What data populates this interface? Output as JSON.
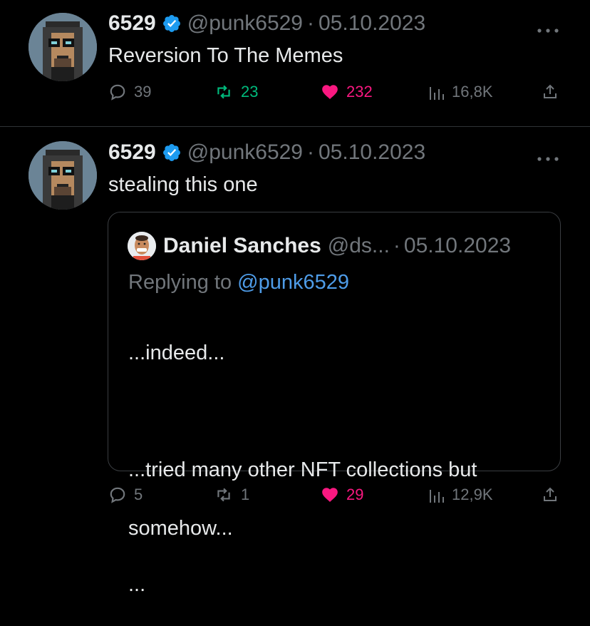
{
  "tweets": [
    {
      "name": "6529",
      "handle": "@punk6529",
      "separator": "·",
      "date": "05.10.2023",
      "text": "Reversion To The Memes",
      "stats": {
        "replies": "39",
        "retweets": "23",
        "likes": "232",
        "views": "16,8K"
      },
      "retweeted": true,
      "liked": true
    },
    {
      "name": "6529",
      "handle": "@punk6529",
      "separator": "·",
      "date": "05.10.2023",
      "text": "stealing this one",
      "quote": {
        "name": "Daniel Sanches",
        "handle": "@ds...",
        "separator": "·",
        "date": "05.10.2023",
        "replying_prefix": "Replying to ",
        "replying_to": "@punk6529",
        "body_lines": [
          "...indeed...",
          "",
          "...tried many other NFT collections but",
          "somehow...",
          "..."
        ]
      },
      "stats": {
        "replies": "5",
        "retweets": "1",
        "likes": "29",
        "views": "12,9K"
      },
      "retweeted": false,
      "liked": true
    }
  ],
  "colors": {
    "background": "#000000",
    "text": "#e7e9ea",
    "muted": "#71767b",
    "verified": "#1d9bf0",
    "retweet_active": "#00ba7c",
    "like_active": "#f91880",
    "mention": "#4e9ce8",
    "divider": "#2f3336"
  },
  "icons": {
    "reply": "reply-icon",
    "retweet": "retweet-icon",
    "like": "heart-icon",
    "views": "views-icon",
    "share": "share-icon",
    "more": "more-icon",
    "verified": "verified-badge-icon"
  }
}
